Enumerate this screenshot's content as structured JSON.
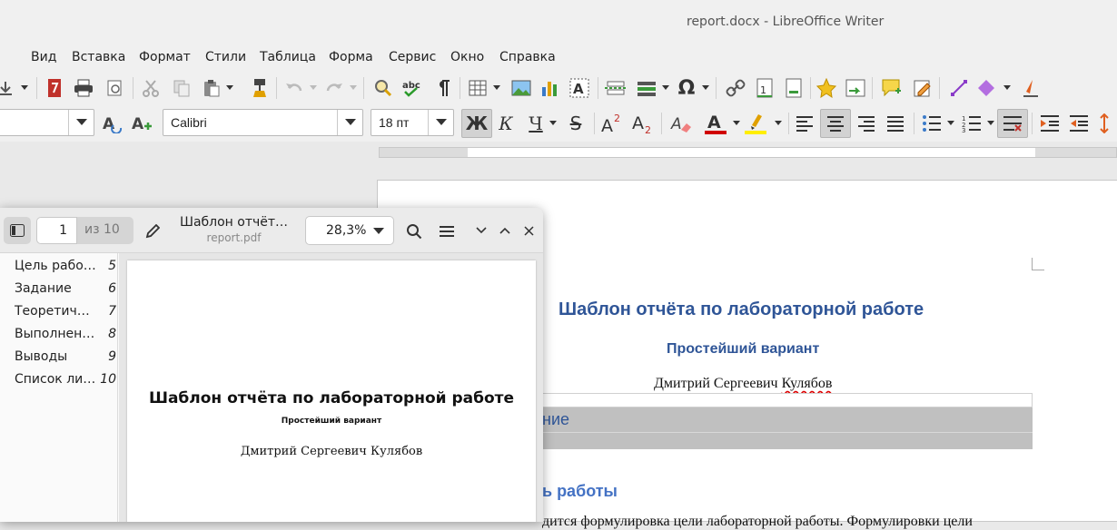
{
  "window": {
    "title": "report.docx - LibreOffice Writer"
  },
  "menu": [
    "Вид",
    "Вставка",
    "Формат",
    "Стили",
    "Таблица",
    "Форма",
    "Сервис",
    "Окно",
    "Справка"
  ],
  "toolbar": {
    "font_name": "Calibri",
    "font_size": "18 пт",
    "bold_label": "Ж",
    "italic_label": "К",
    "underline_label": "Ч",
    "strike_label": "S",
    "colors": {
      "font_color": "#d00000",
      "highlight": "#ffee00",
      "accent": "#2f5597"
    }
  },
  "document": {
    "title": "Шаблон отчёта по лабораторной работе",
    "subtitle": "Простейший вариант",
    "author_first": "Дмитрий Сергеевич ",
    "author_last": "Кулябов",
    "toc_fragment": "ние",
    "heading_fragment": "ь работы",
    "paragraph_fragment": "дится формулировка цели лабораторной работы. Формулировки цели"
  },
  "pdf_viewer": {
    "page_number": "1",
    "page_total": "из 10",
    "doc_title": "Шаблон отчёт…",
    "file_name": "report.pdf",
    "zoom": "28,3%",
    "outline": [
      {
        "label": "Цель работы",
        "page": "5"
      },
      {
        "label": "Задание",
        "page": "6"
      },
      {
        "label": "Теоретиче…",
        "page": "7"
      },
      {
        "label": "Выполнени…",
        "page": "8"
      },
      {
        "label": "Выводы",
        "page": "9"
      },
      {
        "label": "Список лит…",
        "page": "10"
      }
    ],
    "preview": {
      "title": "Шаблон отчёта по лабораторной работе",
      "subtitle": "Простейший вариант",
      "author": "Дмитрий Сергеевич Кулябов"
    }
  }
}
